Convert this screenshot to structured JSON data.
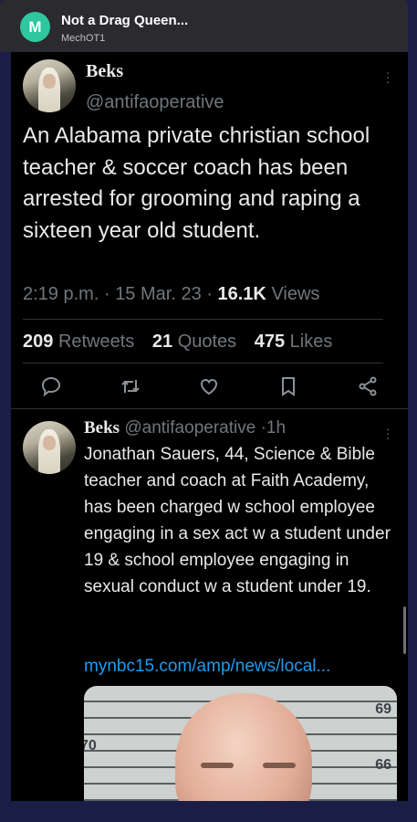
{
  "topbar": {
    "app_icon_letter": "M",
    "title": "Not a Drag Queen...",
    "subtitle": "MechOT1"
  },
  "tweet": {
    "author_name": "Beks",
    "author_handle": "@antifaoperative",
    "text": "An Alabama private christian school teacher & soccer coach has been arrested for grooming and raping a sixteen year old student.",
    "time": "2:19 p.m.",
    "date": "15 Mar. 23",
    "views_count": "16.1K",
    "views_label": "Views",
    "retweets_count": "209",
    "retweets_label": "Retweets",
    "quotes_count": "21",
    "quotes_label": "Quotes",
    "likes_count": "475",
    "likes_label": "Likes",
    "separator": "·"
  },
  "reply": {
    "author_name": "Beks",
    "author_handle": "@antifaoperative",
    "age": "1h",
    "text": "Jonathan Sauers, 44, Science & Bible teacher and coach at Faith Academy, has been charged w school employee engaging in a sex act w a student under 19 & school employee engaging in sexual conduct w a student under 19.",
    "link": "mynbc15.com/amp/news/local...",
    "image_labels": [
      "69",
      "66",
      "70"
    ]
  },
  "icons": [
    "more-icon",
    "reply-icon",
    "retweet-icon",
    "like-icon",
    "bookmark-icon",
    "share-icon"
  ],
  "colors": {
    "background": "#000000",
    "text": "#e7e9ea",
    "muted": "#71767b",
    "link": "#1d9bf0",
    "frame": "#1a1d45"
  }
}
